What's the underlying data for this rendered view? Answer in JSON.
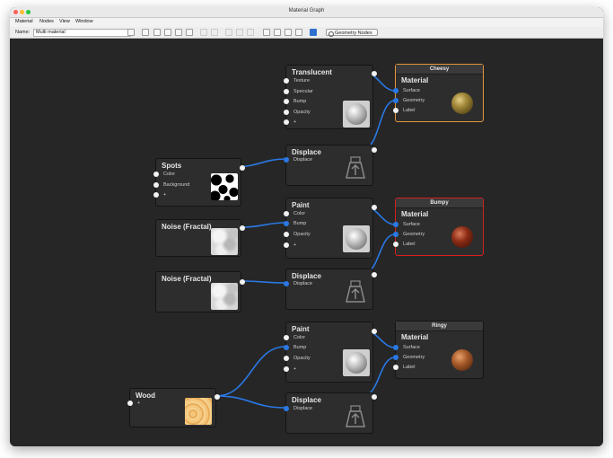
{
  "window": {
    "title": "Material Graph"
  },
  "menu": [
    "Material",
    "Nodes",
    "View",
    "Window"
  ],
  "toolbar": {
    "name_label": "Name:",
    "name_value": "Multi material",
    "geometry_button": "Geometry Nodes"
  },
  "colors": {
    "selected_orange": "#e6953a",
    "selected_red": "#d61f1f",
    "wire_blue": "#2a78e4",
    "canvas": "#262626"
  },
  "nodes": {
    "translucent": {
      "title": "Translucent",
      "ports": [
        "Texture",
        "Specular",
        "Bump",
        "Opacity",
        "+"
      ]
    },
    "spots": {
      "title": "Spots",
      "ports": [
        "Color",
        "Background",
        "+"
      ]
    },
    "displace1": {
      "title": "Displace",
      "ports": [
        "Displace"
      ]
    },
    "cheesy": {
      "header": "Cheesy",
      "title": "Material",
      "ports": [
        "Surface",
        "Geometry",
        "Label"
      ]
    },
    "noise1": {
      "title": "Noise (Fractal)"
    },
    "paint1": {
      "title": "Paint",
      "ports": [
        "Color",
        "Bump",
        "Opacity",
        "+"
      ]
    },
    "bumpy": {
      "header": "Bumpy",
      "title": "Material",
      "ports": [
        "Surface",
        "Geometry",
        "Label"
      ]
    },
    "noise2": {
      "title": "Noise (Fractal)"
    },
    "displace2": {
      "title": "Displace",
      "ports": [
        "Displace"
      ]
    },
    "paint2": {
      "title": "Paint",
      "ports": [
        "Color",
        "Bump",
        "Opacity",
        "+"
      ]
    },
    "ringy": {
      "header": "Ringy",
      "title": "Material",
      "ports": [
        "Surface",
        "Geometry",
        "Label"
      ]
    },
    "wood": {
      "title": "Wood",
      "ports": [
        "+"
      ]
    },
    "displace3": {
      "title": "Displace",
      "ports": [
        "Displace"
      ]
    }
  }
}
